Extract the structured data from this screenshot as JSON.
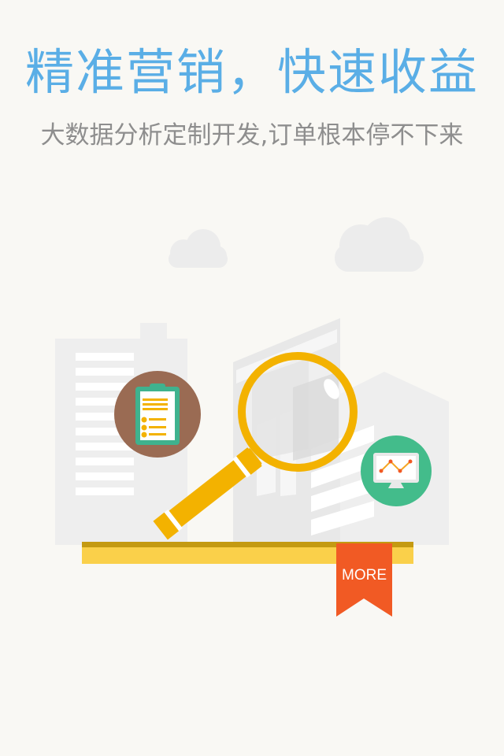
{
  "headline": "精准营销，快速收益",
  "subheadline": "大数据分析定制开发,订单根本停不下来",
  "more_button": {
    "label": "MORE"
  },
  "colors": {
    "headline": "#5aaee6",
    "subheadline": "#8e8e8e",
    "background": "#f9f8f4",
    "magnifier": "#f3b200",
    "ribbon": "#f15a24",
    "shelf": "#fad04a",
    "clipboard_circle": "#9a6b53",
    "monitor_circle": "#43bc8b"
  },
  "icons": {
    "cloud_left": "cloud-icon",
    "cloud_right": "cloud-icon",
    "clipboard": "clipboard-icon",
    "monitor_chart": "monitor-chart-icon",
    "magnifier": "magnifying-glass-icon"
  }
}
